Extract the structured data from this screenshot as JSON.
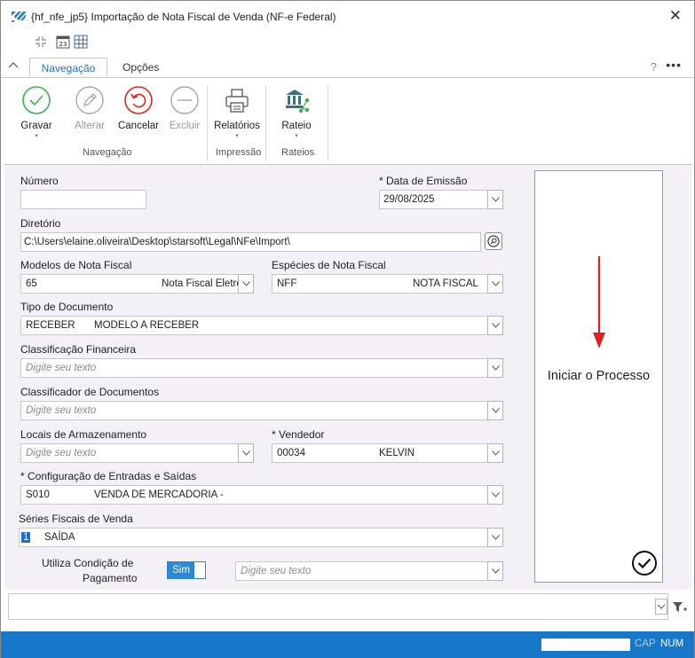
{
  "window": {
    "title": "{hf_nfe_jp5} Importação de Nota Fiscal de Venda (NF-e Federal)",
    "close_glyph": "✕",
    "icon": "app-logo-icon"
  },
  "ribbon": {
    "tabs": [
      {
        "label": "Navegação",
        "active": true
      },
      {
        "label": "Opções",
        "active": false
      }
    ],
    "help_glyph": "?",
    "more_glyph": "•••",
    "buttons": [
      {
        "label": "Gravar",
        "icon": "check-circle-icon",
        "enabled": true,
        "has_dropdown": true
      },
      {
        "label": "Alterar",
        "icon": "pencil-icon",
        "enabled": false
      },
      {
        "label": "Cancelar",
        "icon": "undo-icon",
        "enabled": true
      },
      {
        "label": "Excluir",
        "icon": "minus-circle-icon",
        "enabled": false
      },
      {
        "label": "Relatórios",
        "icon": "printer-icon",
        "enabled": true,
        "has_dropdown": true
      },
      {
        "label": "Rateio",
        "icon": "bank-share-icon",
        "enabled": true,
        "has_dropdown": true
      }
    ],
    "groups": [
      "Navegação",
      "Impressão",
      "Rateios"
    ],
    "dropdown_glyph": "▾"
  },
  "form": {
    "numero": {
      "label": "Número",
      "value": ""
    },
    "data_emissao": {
      "label": "* Data de Emissão",
      "value": "29/08/2025"
    },
    "diretorio": {
      "label": "Diretório",
      "value": "C:\\Users\\elaine.oliveira\\Desktop\\starsoft\\Legal\\NFe\\Import\\"
    },
    "modelos": {
      "label": "Modelos de Nota Fiscal",
      "code": "65",
      "desc": "Nota Fiscal Eletrô"
    },
    "especies": {
      "label": "Espécies de Nota Fiscal",
      "code": "NFF",
      "desc": "NOTA FISCAL"
    },
    "tipo_documento": {
      "label": "Tipo de Documento",
      "code": "RECEBER",
      "desc": "MODELO A RECEBER"
    },
    "classificacao_financeira": {
      "label": "Classificação Financeira",
      "placeholder": "Digite seu texto"
    },
    "classificador_documentos": {
      "label": "Classificador de Documentos",
      "placeholder": "Digite seu texto"
    },
    "locais_armazenamento": {
      "label": "Locais de Armazenamento",
      "placeholder": "Digite seu texto"
    },
    "vendedor": {
      "label": "* Vendedor",
      "code": "00034",
      "desc": "KELVIN"
    },
    "config_entradas_saidas": {
      "label": "* Configuração de Entradas e Saídas",
      "code": "S010",
      "desc": "VENDA DE MERCADORIA -"
    },
    "series_fiscais": {
      "label": "Séries Fiscais de Venda",
      "code": "1",
      "desc": "SAÍDA"
    },
    "condicao_pagamento": {
      "label_line1": "Utiliza Condição de",
      "label_line2": "Pagamento",
      "toggle": "Sim",
      "placeholder": "Digite seu texto"
    }
  },
  "process_panel": {
    "label": "Iniciar o Processo",
    "arrow_color": "#e02020"
  },
  "statusbar": {
    "cap": "CAP",
    "num": "NUM",
    "color": "#1777c9"
  }
}
